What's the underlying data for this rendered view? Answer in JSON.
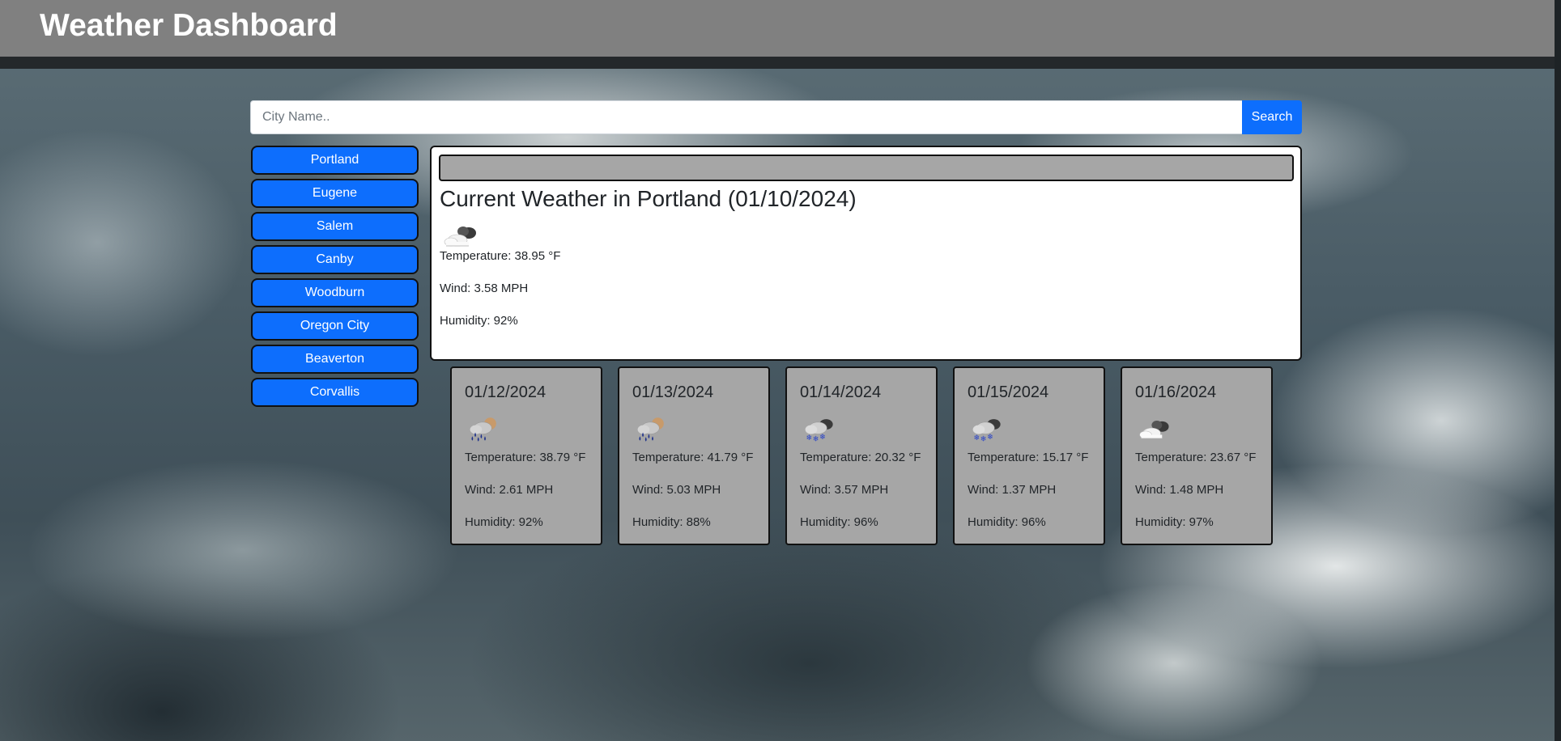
{
  "header": {
    "title": "Weather Dashboard"
  },
  "search": {
    "placeholder": "City Name..",
    "value": "",
    "button_label": "Search"
  },
  "cities": [
    {
      "label": "Portland"
    },
    {
      "label": "Eugene"
    },
    {
      "label": "Salem"
    },
    {
      "label": "Canby"
    },
    {
      "label": "Woodburn"
    },
    {
      "label": "Oregon City"
    },
    {
      "label": "Beaverton"
    },
    {
      "label": "Corvallis"
    }
  ],
  "current": {
    "title": "Current Weather in Portland (01/10/2024)",
    "icon": "cloudy-icon",
    "temperature": "Temperature: 38.95 °F",
    "wind": "Wind: 3.58 MPH",
    "humidity": "Humidity: 92%"
  },
  "forecast": [
    {
      "date": "01/12/2024",
      "icon": "rain-icon",
      "temperature": "Temperature: 38.79 °F",
      "wind": "Wind: 2.61 MPH",
      "humidity": "Humidity: 92%"
    },
    {
      "date": "01/13/2024",
      "icon": "rain-icon",
      "temperature": "Temperature: 41.79 °F",
      "wind": "Wind: 5.03 MPH",
      "humidity": "Humidity: 88%"
    },
    {
      "date": "01/14/2024",
      "icon": "snow-icon",
      "temperature": "Temperature: 20.32 °F",
      "wind": "Wind: 3.57 MPH",
      "humidity": "Humidity: 96%"
    },
    {
      "date": "01/15/2024",
      "icon": "snow-icon",
      "temperature": "Temperature: 15.17 °F",
      "wind": "Wind: 1.37 MPH",
      "humidity": "Humidity: 96%"
    },
    {
      "date": "01/16/2024",
      "icon": "cloudy-icon",
      "temperature": "Temperature: 23.67 °F",
      "wind": "Wind: 1.48 MPH",
      "humidity": "Humidity: 97%"
    }
  ],
  "colors": {
    "accent": "#0d6efd",
    "header": "#808080",
    "card": "#a6a6a6"
  }
}
